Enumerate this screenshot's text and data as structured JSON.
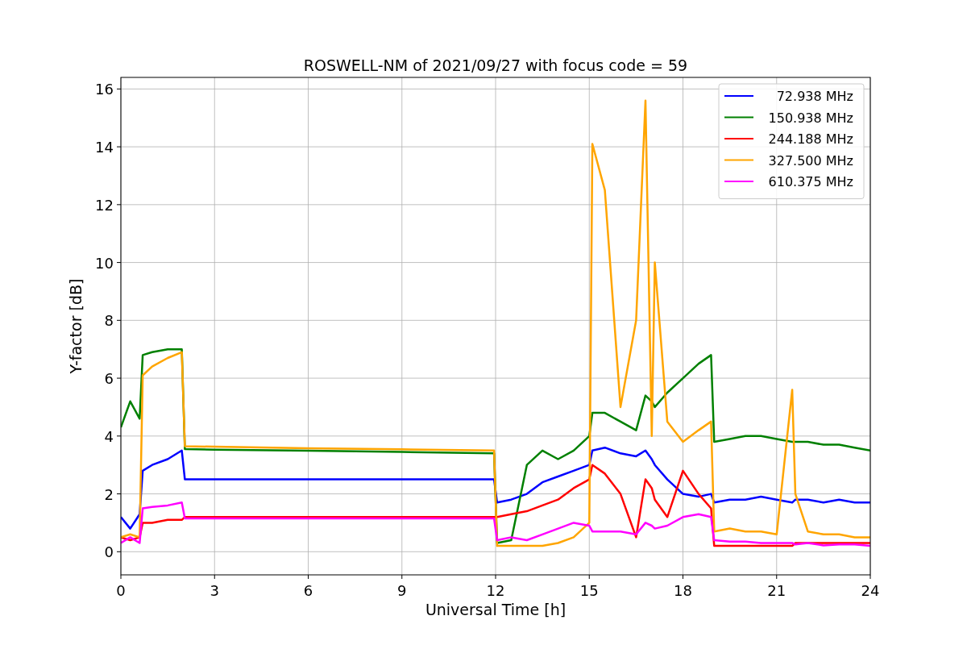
{
  "chart_data": {
    "type": "line",
    "title": "ROSWELL-NM of 2021/09/27 with focus code = 59",
    "xlabel": "Universal Time [h]",
    "ylabel": "Y-factor [dB]",
    "x": [
      0,
      0.3,
      0.6,
      0.7,
      1,
      1.5,
      1.95,
      2.05,
      3,
      6,
      9,
      11.95,
      12.05,
      12.5,
      13,
      13.5,
      14,
      14.5,
      15,
      15.1,
      15.5,
      16,
      16.5,
      16.8,
      17,
      17.1,
      17.5,
      18,
      18.5,
      18.9,
      19,
      19.5,
      20,
      20.5,
      21,
      21.5,
      21.6,
      22,
      22.5,
      23,
      23.5,
      24
    ],
    "series": [
      {
        "name": "72.938 MHz",
        "color": "#0000ff",
        "values": [
          1.2,
          0.8,
          1.3,
          2.8,
          3.0,
          3.2,
          3.5,
          2.5,
          2.5,
          2.5,
          2.5,
          2.5,
          1.7,
          1.8,
          2.0,
          2.4,
          2.6,
          2.8,
          3.0,
          3.5,
          3.6,
          3.4,
          3.3,
          3.5,
          3.2,
          3.0,
          2.5,
          2.0,
          1.9,
          2.0,
          1.7,
          1.8,
          1.8,
          1.9,
          1.8,
          1.7,
          1.8,
          1.8,
          1.7,
          1.8,
          1.7,
          1.7
        ]
      },
      {
        "name": "150.938 MHz",
        "color": "#008000",
        "values": [
          4.3,
          5.2,
          4.6,
          6.8,
          6.9,
          7.0,
          7.0,
          3.55,
          3.53,
          3.49,
          3.45,
          3.4,
          0.3,
          0.4,
          3.0,
          3.5,
          3.2,
          3.5,
          4.0,
          4.8,
          4.8,
          4.5,
          4.2,
          5.4,
          5.2,
          5.0,
          5.5,
          6.0,
          6.5,
          6.8,
          3.8,
          3.9,
          4.0,
          4.0,
          3.9,
          3.8,
          3.8,
          3.8,
          3.7,
          3.7,
          3.6,
          3.5
        ]
      },
      {
        "name": "244.188 MHz",
        "color": "#ff0000",
        "values": [
          0.5,
          0.4,
          0.5,
          1.0,
          1.0,
          1.1,
          1.1,
          1.2,
          1.2,
          1.2,
          1.2,
          1.2,
          1.2,
          1.3,
          1.4,
          1.6,
          1.8,
          2.2,
          2.5,
          3.0,
          2.7,
          2.0,
          0.5,
          2.5,
          2.2,
          1.8,
          1.2,
          2.8,
          2.0,
          1.5,
          0.2,
          0.2,
          0.2,
          0.2,
          0.2,
          0.2,
          0.3,
          0.3,
          0.3,
          0.3,
          0.3,
          0.3
        ]
      },
      {
        "name": "327.500 MHz",
        "color": "#ffa500",
        "values": [
          0.5,
          0.6,
          0.5,
          6.1,
          6.4,
          6.7,
          6.9,
          3.65,
          3.63,
          3.58,
          3.54,
          3.5,
          0.2,
          0.2,
          0.2,
          0.2,
          0.3,
          0.5,
          1.0,
          14.1,
          12.5,
          5.0,
          8.0,
          15.6,
          4.0,
          10.0,
          4.5,
          3.8,
          4.2,
          4.5,
          0.7,
          0.8,
          0.7,
          0.7,
          0.6,
          5.6,
          2.0,
          0.7,
          0.6,
          0.6,
          0.5,
          0.5
        ]
      },
      {
        "name": "610.375 MHz",
        "color": "#ff00ff",
        "values": [
          0.3,
          0.5,
          0.3,
          1.5,
          1.55,
          1.6,
          1.7,
          1.15,
          1.15,
          1.15,
          1.15,
          1.15,
          0.4,
          0.5,
          0.4,
          0.6,
          0.8,
          1.0,
          0.9,
          0.7,
          0.7,
          0.7,
          0.6,
          1.0,
          0.9,
          0.8,
          0.9,
          1.2,
          1.3,
          1.2,
          0.4,
          0.35,
          0.35,
          0.3,
          0.3,
          0.3,
          0.25,
          0.3,
          0.22,
          0.25,
          0.25,
          0.2
        ]
      }
    ],
    "xlim": [
      0,
      24
    ],
    "ylim": [
      -0.8,
      16.4
    ],
    "xticks": [
      0,
      3,
      6,
      9,
      12,
      15,
      18,
      21,
      24
    ],
    "yticks": [
      0,
      2,
      4,
      6,
      8,
      10,
      12,
      14,
      16
    ],
    "grid": true,
    "legend": true
  }
}
